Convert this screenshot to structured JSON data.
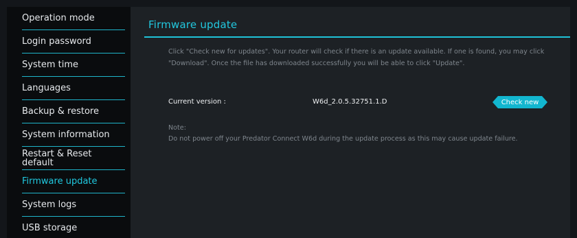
{
  "sidebar": {
    "items": [
      {
        "label": "Operation mode"
      },
      {
        "label": "Login password"
      },
      {
        "label": "System time"
      },
      {
        "label": "Languages"
      },
      {
        "label": "Backup & restore"
      },
      {
        "label": "System information"
      },
      {
        "label": "Restart & Reset\ndefault"
      },
      {
        "label": "Firmware update"
      },
      {
        "label": "System logs"
      },
      {
        "label": "USB storage"
      }
    ]
  },
  "main": {
    "title": "Firmware update",
    "intro": "Click \"Check new for updates\". Your router will check if there is an update available. If one is found, you may click \"Download\". Once the file has downloaded successfully you will be able to click \"Update\".",
    "version_label": "Current version :",
    "version_value": "W6d_2.0.5.32751.1.D",
    "check_button": "Check new",
    "note_label": "Note:",
    "note_text": "Do not power off your Predator Connect W6d during the update process as this may cause update failure."
  },
  "colors": {
    "accent": "#1fc3d9",
    "sidebar_bg": "#0a0c0e",
    "content_bg": "#1d2125",
    "muted_text": "#7f868d"
  }
}
